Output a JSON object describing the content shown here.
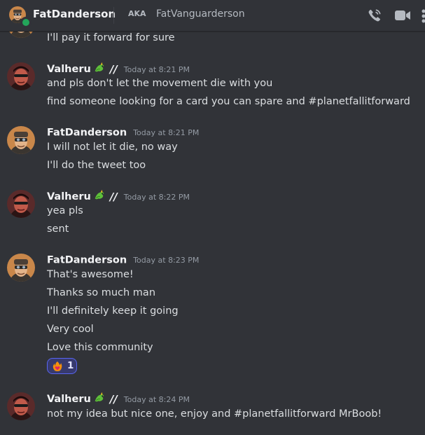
{
  "header": {
    "username": "FatDanderson",
    "aka_label": "AKA",
    "alias": "FatVanguarderson",
    "icons": [
      "phone-call-icon",
      "video-call-icon",
      "more-icon"
    ],
    "status_color": "#23a55a"
  },
  "colors": {
    "background": "#313338",
    "text": "#dbdee1",
    "username": "#f2f3f5",
    "timestamp": "#949ba4",
    "reaction_bg": "#373a6e",
    "reaction_border": "#5865f2"
  },
  "messages": [
    {
      "author": "FatDanderson",
      "lines": [
        "I'll pay it forward for sure"
      ]
    },
    {
      "author": "Valheru",
      "badge": "dragon-emoji",
      "suffix": "//",
      "time": "Today at 8:21 PM",
      "lines": [
        "and pls don't let the movement die with you",
        "find someone looking for a card you can spare and #planetfallitforward"
      ]
    },
    {
      "author": "FatDanderson",
      "time": "Today at 8:21 PM",
      "lines": [
        "I will not let it die, no way",
        "I'll do the tweet too"
      ]
    },
    {
      "author": "Valheru",
      "badge": "dragon-emoji",
      "suffix": "//",
      "time": "Today at 8:22 PM",
      "lines": [
        "yea pls",
        "sent"
      ]
    },
    {
      "author": "FatDanderson",
      "time": "Today at 8:23 PM",
      "lines": [
        "That's awesome!",
        "Thanks so much man",
        "I'll definitely keep it going",
        "Very cool",
        "Love this community"
      ],
      "reaction": {
        "emoji": "fire-heart-emoji",
        "count": "1"
      }
    },
    {
      "author": "Valheru",
      "badge": "dragon-emoji",
      "suffix": "//",
      "time": "Today at 8:24 PM",
      "lines": [
        "not my idea but nice one, enjoy and #planetfallitforward MrBoob!"
      ]
    }
  ]
}
